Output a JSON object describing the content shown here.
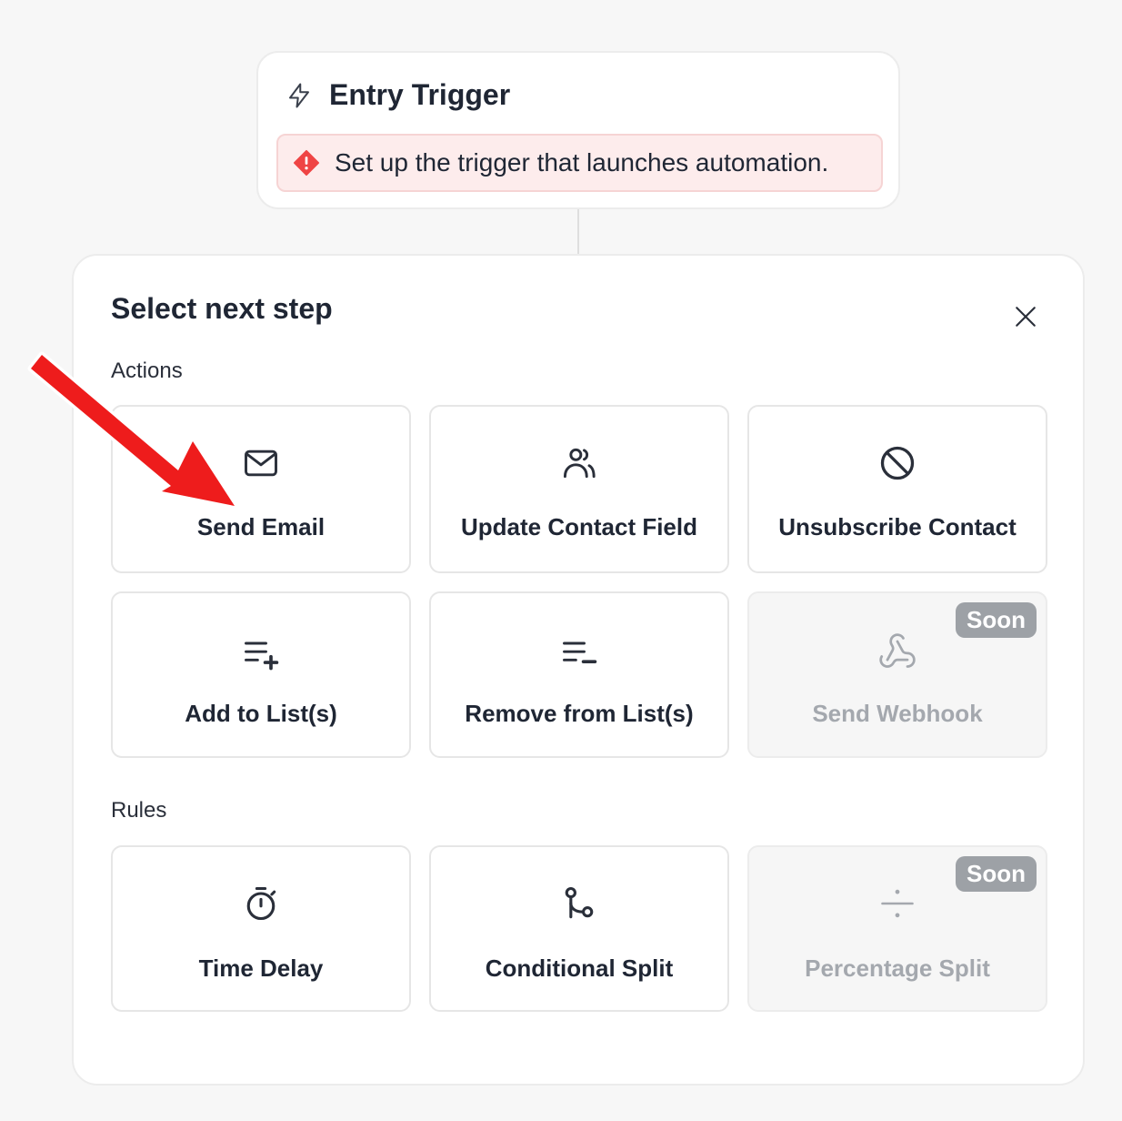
{
  "trigger": {
    "title": "Entry Trigger",
    "icon": "lightning-icon",
    "alert_text": "Set up the trigger that launches automation.",
    "alert_icon": "warning-diamond-icon",
    "alert_color": "#ef4444"
  },
  "panel": {
    "title": "Select next step",
    "close_icon": "close-icon",
    "sections": {
      "actions_label": "Actions",
      "rules_label": "Rules"
    }
  },
  "actions": [
    {
      "label": "Send Email",
      "icon": "mail-icon",
      "disabled": false
    },
    {
      "label": "Update Contact Field",
      "icon": "users-icon",
      "disabled": false
    },
    {
      "label": "Unsubscribe Contact",
      "icon": "ban-icon",
      "disabled": false
    },
    {
      "label": "Add to List(s)",
      "icon": "list-add-icon",
      "disabled": false
    },
    {
      "label": "Remove from List(s)",
      "icon": "list-remove-icon",
      "disabled": false
    },
    {
      "label": "Send Webhook",
      "icon": "webhook-icon",
      "disabled": true,
      "badge": "Soon"
    }
  ],
  "rules": [
    {
      "label": "Time Delay",
      "icon": "stopwatch-icon",
      "disabled": false
    },
    {
      "label": "Conditional Split",
      "icon": "split-route-icon",
      "disabled": false
    },
    {
      "label": "Percentage Split",
      "icon": "divide-icon",
      "disabled": true,
      "badge": "Soon"
    }
  ],
  "annotation": {
    "icon": "red-arrow-pointer",
    "color": "#ee1c1c"
  }
}
